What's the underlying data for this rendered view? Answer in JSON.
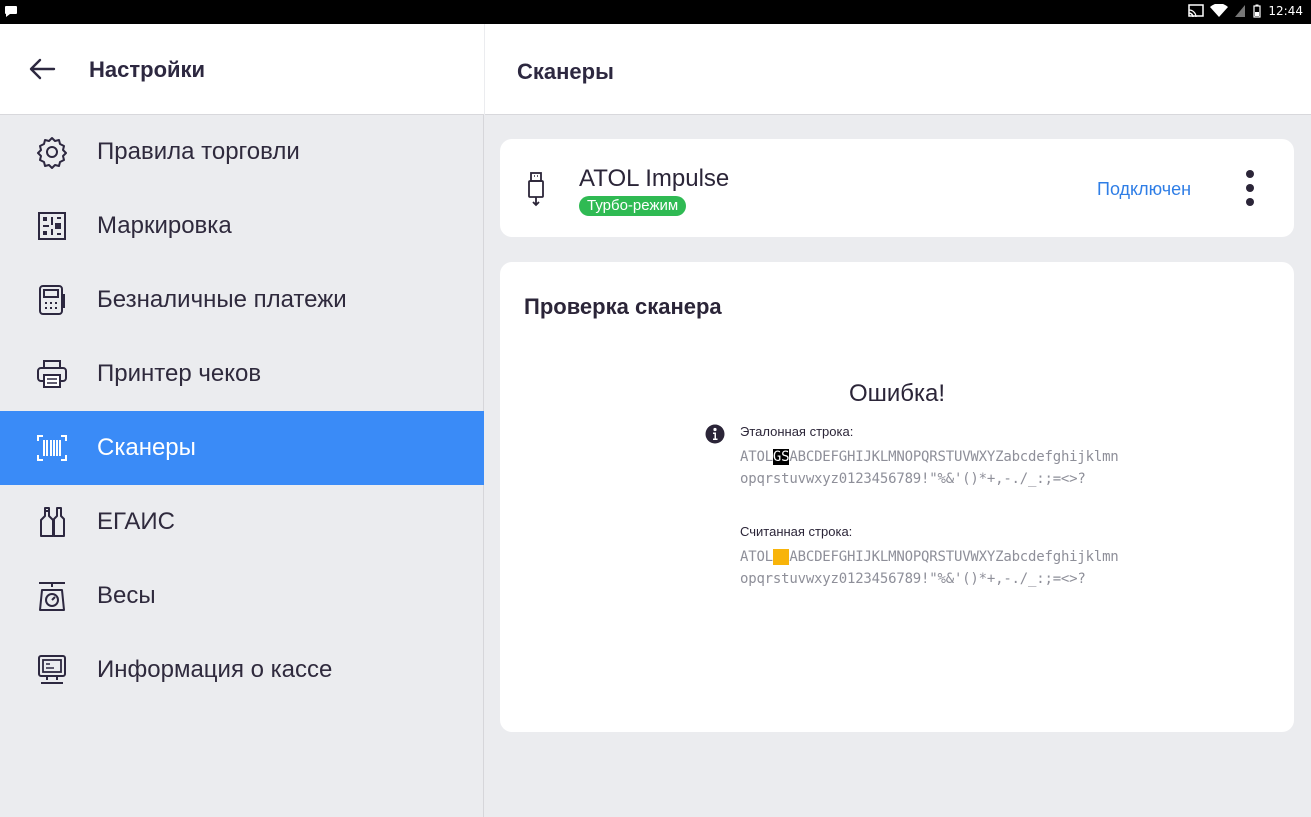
{
  "statusbar": {
    "time": "12:44"
  },
  "header": {
    "back_icon": "arrow-left-icon",
    "title": "Настройки"
  },
  "menu": [
    {
      "label": "Правила торговли",
      "icon": "gear-icon",
      "selected": false
    },
    {
      "label": "Маркировка",
      "icon": "datamatrix-icon",
      "selected": false
    },
    {
      "label": "Безналичные платежи",
      "icon": "payment-terminal-icon",
      "selected": false
    },
    {
      "label": "Принтер чеков",
      "icon": "printer-icon",
      "selected": false
    },
    {
      "label": "Сканеры",
      "icon": "barcode-scanner-icon",
      "selected": true
    },
    {
      "label": "ЕГАИС",
      "icon": "bottles-icon",
      "selected": false
    },
    {
      "label": "Весы",
      "icon": "scales-icon",
      "selected": false
    },
    {
      "label": "Информация о кассе",
      "icon": "cash-register-icon",
      "selected": false
    }
  ],
  "page": {
    "title": "Сканеры"
  },
  "device": {
    "name": "ATOL Impulse",
    "mode_badge": "Турбо-режим",
    "status": "Подключен",
    "icon": "usb-icon",
    "more_icon": "more-vertical-icon"
  },
  "check": {
    "title": "Проверка сканера",
    "result": "Ошибка!",
    "reference_label": "Эталонная строка:",
    "reference_prefix": "ATOL",
    "reference_marker": "GS",
    "reference_rest": "ABCDEFGHIJKLMNOPQRSTUVWXYZabcdefghijklmnopqrstuvwxyz0123456789!\"%&'()*+,-./_:;=<>?",
    "read_label": "Считанная строка:",
    "read_prefix": "ATOL",
    "read_marker": "  ",
    "read_rest": "ABCDEFGHIJKLMNOPQRSTUVWXYZabcdefghijklmnopqrstuvwxyz0123456789!\"%&'()*+,-./_:;=<>?",
    "colors": {
      "marker_ok": "#000000",
      "marker_missing": "#f8b40a",
      "accent": "#3a8bf7",
      "badge": "#2fba53"
    }
  }
}
